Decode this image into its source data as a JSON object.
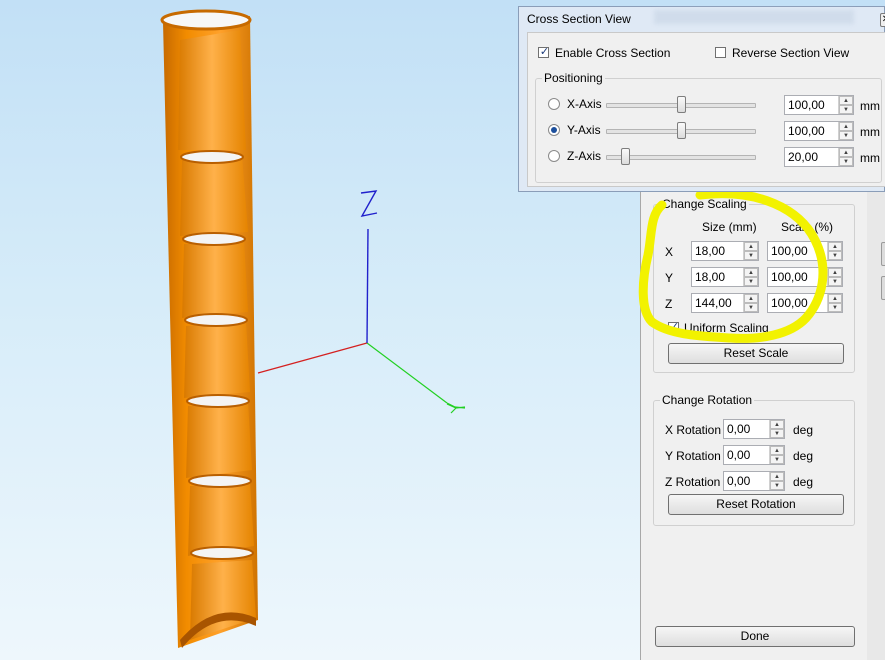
{
  "cross_section_window": {
    "title": "Cross Section View",
    "enable_label": "Enable Cross Section",
    "enable_checked": true,
    "reverse_label": "Reverse Section View",
    "reverse_checked": false,
    "positioning_title": "Positioning",
    "axes": [
      {
        "label": "X-Axis",
        "value": "100,00",
        "unit": "mm",
        "selected": false,
        "slider_fraction": 0.5
      },
      {
        "label": "Y-Axis",
        "value": "100,00",
        "unit": "mm",
        "selected": true,
        "slider_fraction": 0.5
      },
      {
        "label": "Z-Axis",
        "value": "20,00",
        "unit": "mm",
        "selected": false,
        "slider_fraction": 0.1
      }
    ]
  },
  "scaling": {
    "title": "Change Scaling",
    "size_header": "Size (mm)",
    "scale_header": "Scale (%)",
    "rows": [
      {
        "axis": "X",
        "size": "18,00",
        "scale": "100,00"
      },
      {
        "axis": "Y",
        "size": "18,00",
        "scale": "100,00"
      },
      {
        "axis": "Z",
        "size": "144,00",
        "scale": "100,00"
      }
    ],
    "uniform_label": "Uniform Scaling",
    "uniform_checked": true,
    "reset_label": "Reset Scale"
  },
  "rotation": {
    "title": "Change Rotation",
    "rows": [
      {
        "label": "X Rotation",
        "value": "0,00",
        "unit": "deg"
      },
      {
        "label": "Y Rotation",
        "value": "0,00",
        "unit": "deg"
      },
      {
        "label": "Z Rotation",
        "value": "0,00",
        "unit": "deg"
      }
    ],
    "reset_label": "Reset Rotation"
  },
  "done_label": "Done",
  "colors": {
    "model": "#f28c00",
    "model_dark": "#b95f00",
    "model_light": "#ffb347",
    "highlight": "#f2f200",
    "axis_x": "#d42020",
    "axis_y": "#22d022",
    "axis_z": "#2020cc"
  }
}
